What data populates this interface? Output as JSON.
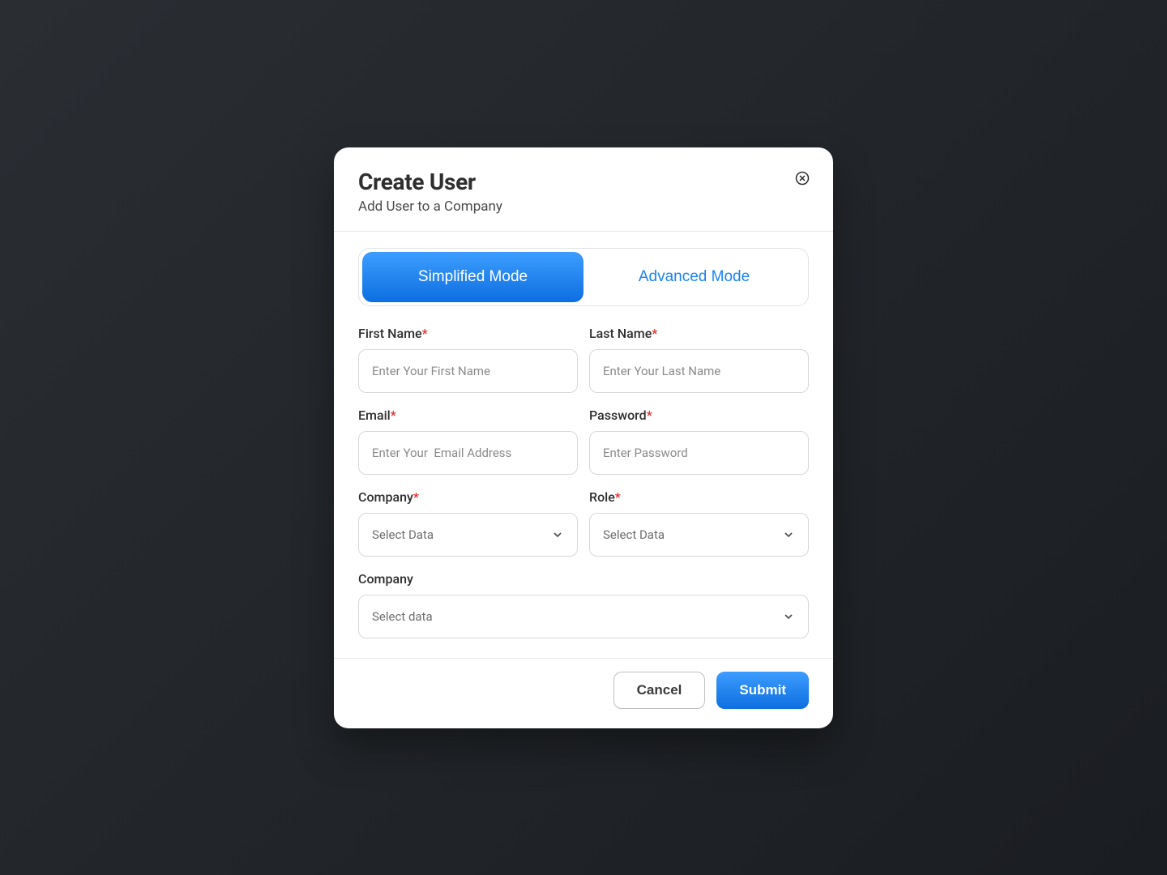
{
  "modal": {
    "title": "Create User",
    "subtitle": "Add User to a Company"
  },
  "modes": {
    "simplified": "Simplified Mode",
    "advanced": "Advanced Mode"
  },
  "fields": {
    "first_name": {
      "label": "First Name",
      "placeholder": "Enter Your First Name",
      "required": true
    },
    "last_name": {
      "label": "Last Name",
      "placeholder": "Enter Your Last Name",
      "required": true
    },
    "email": {
      "label": "Email",
      "placeholder": "Enter Your  Email Address",
      "required": true
    },
    "password": {
      "label": "Password",
      "placeholder": "Enter Password",
      "required": true
    },
    "company": {
      "label": "Company",
      "placeholder": "Select Data",
      "required": true
    },
    "role": {
      "label": "Role",
      "placeholder": "Select Data",
      "required": true
    },
    "company2": {
      "label": "Company",
      "placeholder": "Select data",
      "required": false
    }
  },
  "footer": {
    "cancel": "Cancel",
    "submit": "Submit"
  },
  "required_marker": "*"
}
